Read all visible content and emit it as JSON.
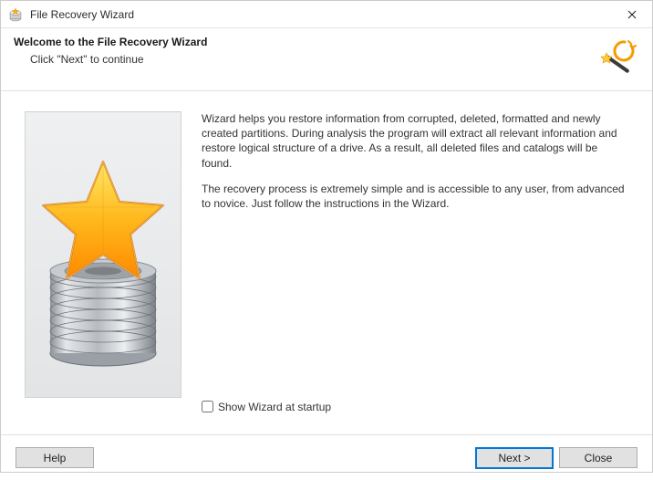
{
  "window": {
    "title": "File Recovery Wizard"
  },
  "header": {
    "heading": "Welcome to the File Recovery Wizard",
    "sub": "Click \"Next\" to continue"
  },
  "body": {
    "p1": "Wizard helps you restore information from corrupted, deleted, formatted and newly created partitions. During analysis the program will extract all relevant information and restore logical structure of a drive. As a result, all deleted files and catalogs will be found.",
    "p2": "The recovery process is extremely simple and is accessible to any user, from advanced to novice. Just follow the instructions in the Wizard."
  },
  "checkbox": {
    "label": "Show Wizard at startup",
    "checked": false
  },
  "buttons": {
    "help": "Help",
    "next": "Next >",
    "close": "Close"
  }
}
